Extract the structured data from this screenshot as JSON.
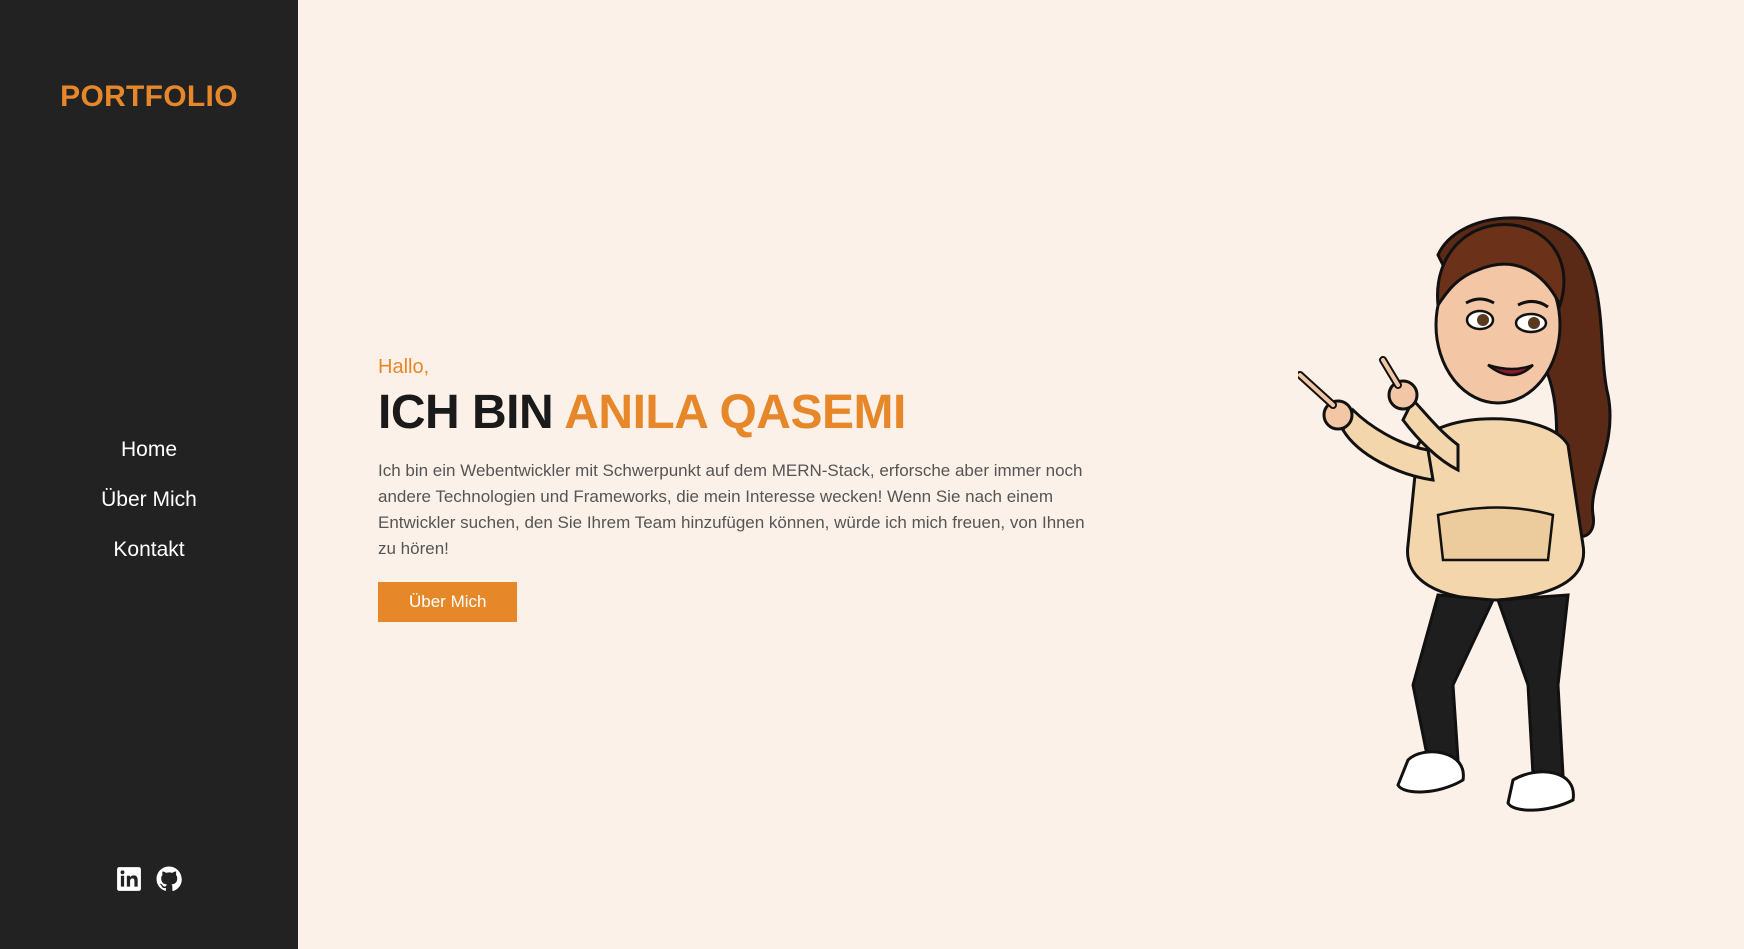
{
  "sidebar": {
    "brand": "PORTFOLIO",
    "nav": [
      {
        "label": "Home"
      },
      {
        "label": "Über Mich"
      },
      {
        "label": "Kontakt"
      }
    ],
    "social": [
      {
        "icon": "linkedin-icon"
      },
      {
        "icon": "github-icon"
      }
    ]
  },
  "hero": {
    "greeting": "Hallo,",
    "headline_prefix": "ICH BIN",
    "headline_name": "ANILA QASEMI",
    "intro": "Ich bin ein Webentwickler mit Schwerpunkt auf dem MERN-Stack, erforsche aber immer noch andere Technologien und Frameworks, die mein Interesse wecken! Wenn Sie nach einem Entwickler suchen, den Sie Ihrem Team hinzufügen können, würde ich mich freuen, von Ihnen zu hören!",
    "cta_label": "Über Mich"
  },
  "colors": {
    "accent": "#e6882a",
    "sidebar_bg": "#222222",
    "page_bg": "#fcf1e8"
  }
}
